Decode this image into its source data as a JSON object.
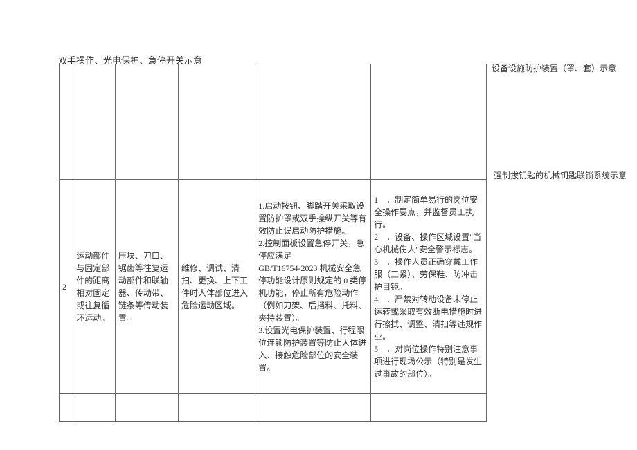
{
  "header": "双手操作、光电保护、急停开关示意",
  "caption_right_1": "设备设施防护装置（罩、套）示意",
  "caption_right_2": "强制拔钥匙的机械钥匙联锁系统示意",
  "table": {
    "row": {
      "index": "2",
      "category": "运动部件与固定部件的距离相对固定或往复循环运动。",
      "parts": "压块、刀口、锯齿等往复运动部件和联轴器、传动带、链条等传动装置。",
      "maintenance": "维修、调试、清扫、更换、上下工件时人体部位进入危险运动区域。",
      "measures": "1.启动按钮、脚踏开关采取设置防护罩或双手操纵开关等有效防止误启动防护措施。\n2.控制面板设置急停开关，急停应满足\nGB/T16754-2023 机械安全急停功能设计原则规定的 0 类停机功能，停止所有危险动作（例如刀架、后挡料、托料、夹持装置）。\n3.设置光电保护装置、行程限位连锁防护装置等防止人体进入、接触危险部位的安全装置。",
      "management": "1　．制定简单易行的岗位安全操作要点，并监督员工执行。\n2　．设备、操作区域设置\"当心机械伤人\"安全警示标志。\n3　．操作人员正确穿戴工作服（三紧）、劳保鞋、防冲击护目镜。\n4　．严禁对转动设备未停止运转或采取有效断电措施时进行擦拭、调整、清扫等违规作业。\n5　．对岗位操作特别注意事项进行现场公示（特别是发生过事故的部位）。"
    }
  }
}
